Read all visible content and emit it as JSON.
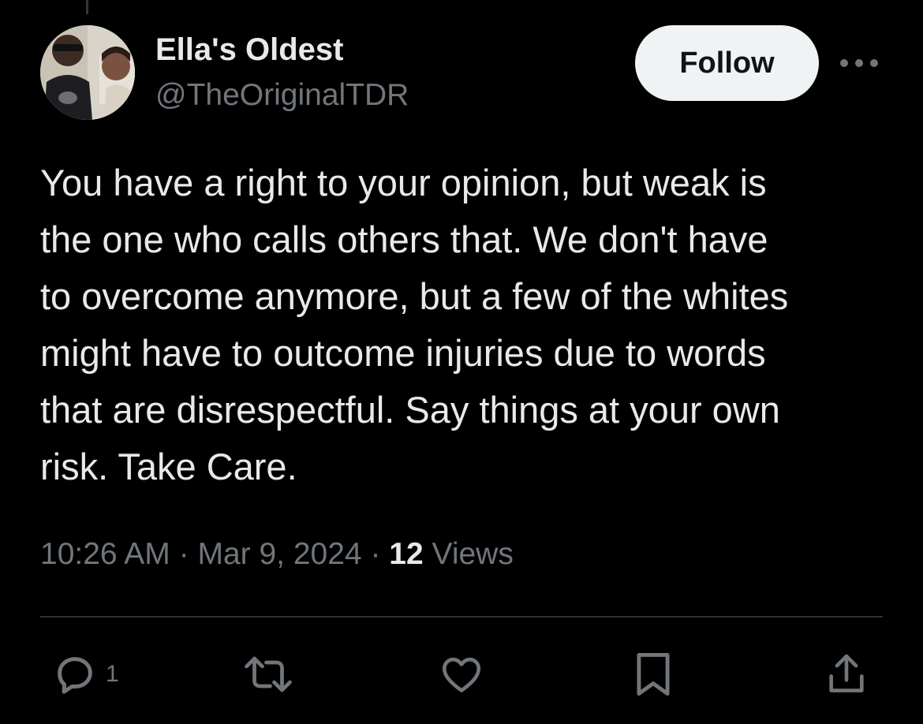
{
  "author": {
    "display_name": "Ella's Oldest",
    "handle": "@TheOriginalTDR"
  },
  "follow_label": "Follow",
  "more_icon": "more-horizontal-icon",
  "tweet": {
    "text": "You have a right to your opinion, but weak is\nthe one who calls others that. We don't have\nto overcome anymore, but a few of the whites\nmight have to outcome injuries due to words\nthat are disrespectful. Say things at your own\nrisk. Take Care."
  },
  "meta": {
    "time": "10:26 AM",
    "separator": "·",
    "date": "Mar 9, 2024",
    "views_count": "12",
    "views_label": "Views"
  },
  "actions": {
    "reply_icon": "reply-icon",
    "reply_count": "1",
    "retweet_icon": "retweet-icon",
    "like_icon": "heart-icon",
    "bookmark_icon": "bookmark-icon",
    "share_icon": "share-icon"
  },
  "colors": {
    "background": "#000000",
    "primary_text": "#e7e9ea",
    "secondary_text": "#71767b",
    "divider": "#2f3336",
    "follow_bg": "#eff3f4"
  }
}
